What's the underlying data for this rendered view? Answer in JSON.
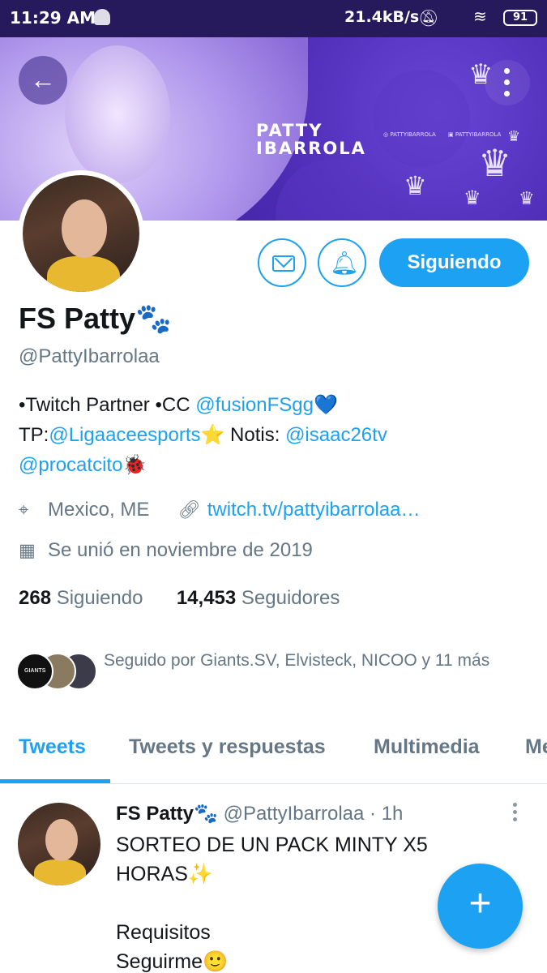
{
  "statusbar": {
    "time": "11:29 AM",
    "speed": "21.4kB/s",
    "battery": "91"
  },
  "banner": {
    "title_line1": "PATTY",
    "title_line2": "IBARROLA",
    "social_instagram": "PATTYIBARROLA",
    "social_twitch": "PATTYIBARROLA"
  },
  "actions": {
    "follow_label": "Siguiendo"
  },
  "profile": {
    "name": "FS Patty🐾",
    "handle": "@PattyIbarrolaa",
    "bio": {
      "line1_prefix": "•Twitch Partner •CC ",
      "line1_mention": "@fusionFSgg",
      "line1_emoji": "💙",
      "line2_prefix": "TP:",
      "line2_mention": "@Ligaaceesports",
      "line2_emoji": "⭐",
      "line2_mid": " Notis: ",
      "line2_mention2": "@isaac26tv",
      "line3_mention": "@procatcito",
      "line3_emoji": "🐞"
    },
    "location": "Mexico, ME",
    "website": "twitch.tv/pattyibarrolaa…",
    "joined": "Se unió en noviembre de 2019",
    "following_count": "268",
    "following_label": "Siguiendo",
    "followers_count": "14,453",
    "followers_label": "Seguidores",
    "followed_by": "Seguido por Giants.SV, Elvisteck, NICOO y 11 más",
    "followed_avatar_text": "GIANTS"
  },
  "tabs": [
    {
      "label": "Tweets",
      "active": true
    },
    {
      "label": "Tweets y respuestas",
      "active": false
    },
    {
      "label": "Multimedia",
      "active": false
    },
    {
      "label": "Me",
      "active": false
    }
  ],
  "tweet": {
    "name": "FS Patty🐾",
    "handle": "@PattyIbarrolaa",
    "separator": " · ",
    "time": "1h",
    "line1": "SORTEO DE UN PACK MINTY X5",
    "line2": "HORAS✨",
    "line3": "Requisitos",
    "line4": "Seguirme🙂"
  },
  "fab": {
    "icon": "+"
  },
  "colors": {
    "accent": "#1da1f2",
    "statusbar": "#271a5c",
    "secondary_text": "#657786"
  }
}
